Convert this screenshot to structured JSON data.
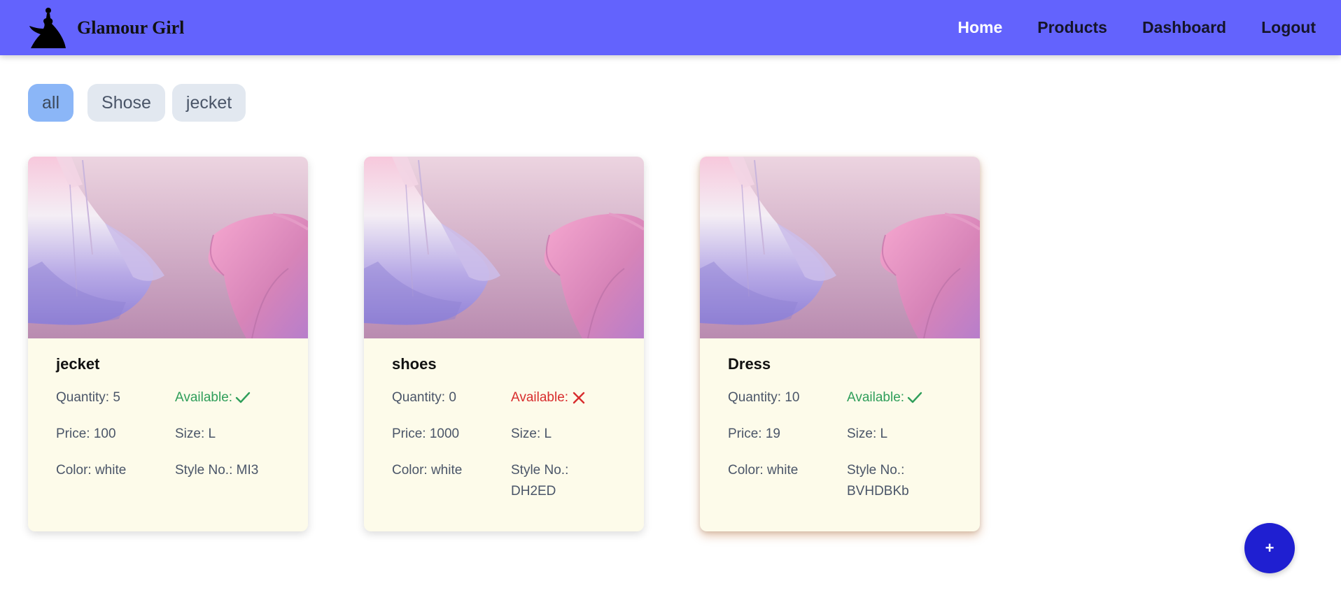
{
  "header": {
    "brand_name": "Glamour Girl",
    "logo_icon": "dress-silhouette-icon",
    "nav": [
      {
        "label": "Home",
        "active": true
      },
      {
        "label": "Products",
        "active": false
      },
      {
        "label": "Dashboard",
        "active": false
      },
      {
        "label": "Logout",
        "active": false
      }
    ]
  },
  "filters": [
    {
      "label": "all",
      "active": true
    },
    {
      "label": "Shose",
      "active": false
    },
    {
      "label": "jecket",
      "active": false
    }
  ],
  "products": [
    {
      "name": "jecket",
      "quantity": "Quantity: 5",
      "available_label": "Available:",
      "available": true,
      "price": "Price: 100",
      "size": "Size: L",
      "color": "Color: white",
      "style": "Style No.: MI3"
    },
    {
      "name": "shoes",
      "quantity": "Quantity: 0",
      "available_label": "Available:",
      "available": false,
      "price": "Price: 1000",
      "size": "Size: L",
      "color": "Color: white",
      "style": "Style No.: DH2ED"
    },
    {
      "name": "Dress",
      "quantity": "Quantity: 10",
      "available_label": "Available:",
      "available": true,
      "price": "Price: 19",
      "size": "Size: L",
      "color": "Color: white",
      "style": "Style No.: BVHDBKb"
    }
  ],
  "fab": {
    "label": "+",
    "icon": "plus-icon"
  },
  "colors": {
    "navbar": "#6363fd",
    "fab": "#1f1fd1",
    "available_yes": "#2f9e5a",
    "available_no": "#d82d2d",
    "card_body": "#fdfbea",
    "chip_active": "#8bb6f7",
    "chip": "#e2e8f0"
  }
}
